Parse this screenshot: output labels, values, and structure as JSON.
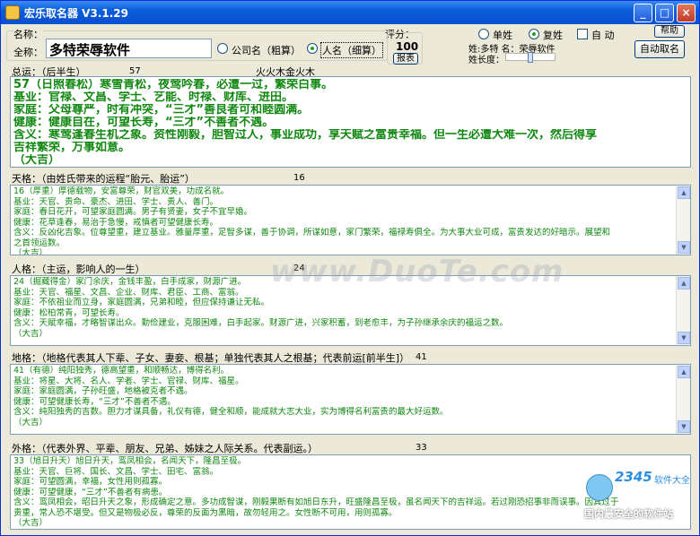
{
  "window": {
    "title": "宏乐取名器  V3.1.29"
  },
  "form": {
    "name_label": "名称：",
    "fullname_label": "全称：",
    "fullname_value": "多特荣辱软件",
    "company_radio": "公司名（粗算）",
    "person_radio": "人名（细算）",
    "score_label": "评分：",
    "score_value": "100",
    "report_button": "报表",
    "single_radio": "单姓",
    "double_radio": "复姓",
    "auto_check": "自 动",
    "help_button": "帮助",
    "surname_info": "姓:多特   名：荣辱软件",
    "surname_length_label": "姓长度：",
    "auto_name_button": "自动取名"
  },
  "sections": [
    {
      "label": "总运：（后半生）",
      "num": "57",
      "extra": "火火木金火木",
      "lines": [
        "57（日照春松）寒雪青松，夜莺吟春，必遭一过，繁荣白事。",
        "基业：官禄、文昌、学士、艺能、时禄、财库、进田。",
        "家庭：父母尊严，时有冲突，“三才”善良者可和睦圆满。",
        "健康：健康自在，可望长寿，“三才”不善者不遇。",
        "含义：寒莺逢春生机之象。资性刚毅，胆智过人，事业成功，享天赋之富贵幸福。但一生必遭大难一次，然后得享",
        "吉祥繁荣，万事如意。",
        "（大吉）"
      ]
    },
    {
      "label": "天格：（由姓氏带来的运程“胎元、胎运”）",
      "num": "16",
      "lines": [
        "16（厚重）厚德载物，安富尊荣，财官双美，功成名就。",
        "基业：天官、贵命、豪杰、进田、学士、贵人、善门。",
        "家庭：春日花开，可望家庭圆满。男子有贤妻，女子不宜早婚。",
        "健康：花草逢春，易治于急慢，戒慎者可望健康长寿。",
        "含义：反凶化吉象。位尊望重，建立基业。雅量厚重，足智多谋，善于协调，所谋如意，家门繁荣，福禄寿俱全。为大事大业可成，富贵发达的好暗示。展望和",
        "之首领运数。",
        "（大吉）"
      ]
    },
    {
      "label": "人格：（主运，影响人的一生）",
      "num": "24",
      "lines": [
        "24（掘藏得金）家门余庆，金钱丰盈，白手成家，财源广进。",
        "基业：天官、福星、文昌、企业、财库、君臣、工商、富翁。",
        "家庭：不依祖业而立身，家庭圆满，兄弟和睦，但应保持谦让无私。",
        "健康：松柏常青，可望长寿。",
        "含义：天赋幸福，才略智谋出众。勤俭建业，克服困难，白手起家。财源广进，兴家积蓄，到老愈丰，为子孙继承余庆的福运之数。",
        "（大吉）"
      ]
    },
    {
      "label": "地格：（地格代表其人下辈、子女、妻妾、根基；单独代表其人之根基；代表前运[前半生]）",
      "num": "41",
      "lines": [
        "41（有德）纯阳独秀，德高望重，和顺畅达，博得名利。",
        "基业：将星、大将、名人、学者、学士、官禄、财库、福星。",
        "家庭：家庭圆满，子孙旺盛，地格被克者不遇。",
        "健康：可望健康长寿，“三才”不善者不遇。",
        "含义：纯阳独秀的吉数。胆力才谋具备，礼仪有德，健全和顺，能成就大志大业，实为博得名利富贵的最大好运数。",
        "（大吉）"
      ]
    },
    {
      "label": "外格：（代表外界、平辈、朋友、兄弟、姊妹之人际关系。代表副运。）",
      "num": "33",
      "lines": [
        "33（旭日升天）旭日升天，鸾凤相会，名闻天下，隆昌至极。",
        "基业：天官、巨将、国长、文昌、学士、田宅、富翁。",
        "家庭：可望圆满，幸福，女性用则孤寡。",
        "健康：可望健康，“三才”不善者有病患。",
        "含义：鸾凤相会，昭日升天之象，形成确定之意。多功成智谋，刚毅果断有如旭日东升，旺盛隆昌至极，虽名闻天下的吉祥运。若过刚恐招事非而误事。因其过于",
        "贵重，常人恐不堪受。但又是物极必反，尊荣的反面为黑暗，故勿轻用之。女性断不可用，用则孤寡。",
        "（大吉）"
      ]
    }
  ],
  "watermark": "www.DuoTe.com",
  "corner": {
    "brand": "2345",
    "brand_suffix": "软件大全",
    "tagline": "国内最安全的软件站"
  }
}
